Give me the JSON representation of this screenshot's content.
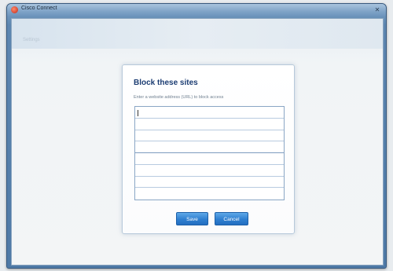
{
  "window": {
    "title": "Cisco Connect",
    "close_glyph": "✕"
  },
  "topbar": {
    "label": "Settings"
  },
  "dialog": {
    "title": "Block these sites",
    "instruction": "Enter a website address (URL) to block access",
    "site_entries": [
      "",
      "",
      "",
      "",
      "",
      "",
      "",
      ""
    ],
    "save_label": "Save",
    "cancel_label": "Cancel"
  },
  "footer": {
    "label": ""
  },
  "colors": {
    "accent": "#2f7fd0",
    "dialog_title": "#1c3d73",
    "window_frame": "#4e79a6"
  }
}
